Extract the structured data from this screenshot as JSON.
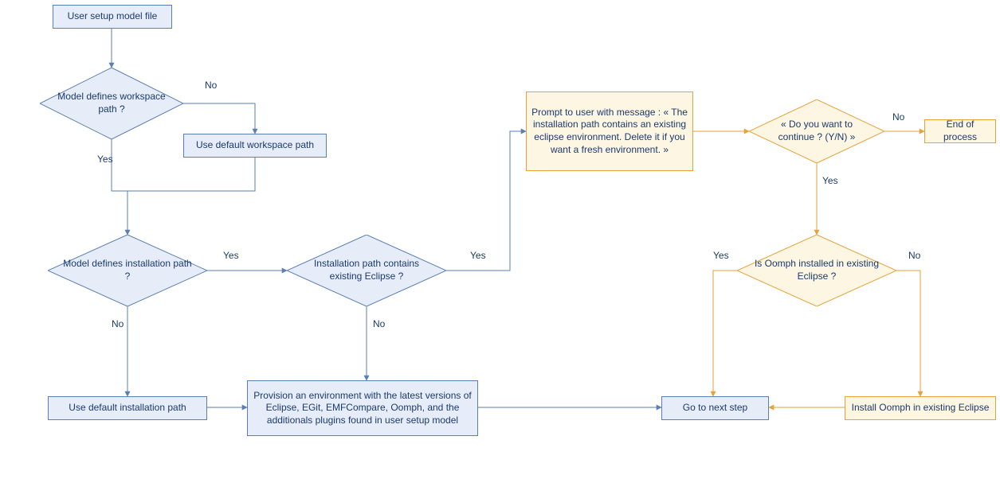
{
  "nodes": {
    "start": "User setup model file",
    "d_workspace": "Model defines workspace path ?",
    "use_default_ws": "Use default workspace path",
    "d_install": "Model defines installation path ?",
    "d_existing": "Installation path contains existing Eclipse ?",
    "use_default_install": "Use default installation path",
    "provision": "Provision an environment with the latest versions of Eclipse, EGit, EMFCompare, Oomph, and the additionals plugins found in user setup model",
    "prompt": "Prompt to user with message : « The installation path contains an existing eclipse environment. Delete it if you want a fresh environment. »",
    "d_continue": "« Do you want to continue ? (Y/N) »",
    "end": "End of process",
    "d_oomph": "Is Oomph installed in existing Eclipse ?",
    "install_oomph": "Install Oomph in existing Eclipse",
    "goto_next": "Go to next step"
  },
  "labels": {
    "yes": "Yes",
    "no": "No"
  },
  "colors": {
    "blue_stroke": "#5a7fb5",
    "blue_fill": "#e6ecf8",
    "orange_stroke": "#e6a23c",
    "orange_fill": "#fdf6e3"
  },
  "chart_data": {
    "type": "flowchart",
    "nodes": [
      {
        "id": "start",
        "type": "process",
        "text": "User setup model file",
        "style": "blue"
      },
      {
        "id": "d_workspace",
        "type": "decision",
        "text": "Model defines workspace path ?",
        "style": "blue"
      },
      {
        "id": "use_default_ws",
        "type": "process",
        "text": "Use default workspace path",
        "style": "blue"
      },
      {
        "id": "d_install",
        "type": "decision",
        "text": "Model defines installation path ?",
        "style": "blue"
      },
      {
        "id": "d_existing",
        "type": "decision",
        "text": "Installation path contains existing Eclipse ?",
        "style": "blue"
      },
      {
        "id": "use_default_install",
        "type": "process",
        "text": "Use default installation path",
        "style": "blue"
      },
      {
        "id": "provision",
        "type": "process",
        "text": "Provision an environment with the latest versions of Eclipse, EGit, EMFCompare, Oomph, and the additionals plugins found in user setup model",
        "style": "blue"
      },
      {
        "id": "prompt",
        "type": "process",
        "text": "Prompt to user with message : « The installation path contains an existing eclipse environment. Delete it if you want a fresh environment. »",
        "style": "orange"
      },
      {
        "id": "d_continue",
        "type": "decision",
        "text": "« Do you want to continue ? (Y/N) »",
        "style": "orange"
      },
      {
        "id": "end",
        "type": "process",
        "text": "End of process",
        "style": "orange"
      },
      {
        "id": "d_oomph",
        "type": "decision",
        "text": "Is Oomph installed in existing Eclipse ?",
        "style": "orange"
      },
      {
        "id": "install_oomph",
        "type": "process",
        "text": "Install Oomph in existing Eclipse",
        "style": "orange"
      },
      {
        "id": "goto_next",
        "type": "process",
        "text": "Go to next step",
        "style": "blue"
      }
    ],
    "edges": [
      {
        "from": "start",
        "to": "d_workspace"
      },
      {
        "from": "d_workspace",
        "to": "use_default_ws",
        "label": "No"
      },
      {
        "from": "d_workspace",
        "to": "d_install",
        "label": "Yes"
      },
      {
        "from": "use_default_ws",
        "to": "d_install"
      },
      {
        "from": "d_install",
        "to": "d_existing",
        "label": "Yes"
      },
      {
        "from": "d_install",
        "to": "use_default_install",
        "label": "No"
      },
      {
        "from": "use_default_install",
        "to": "provision"
      },
      {
        "from": "d_existing",
        "to": "provision",
        "label": "No"
      },
      {
        "from": "d_existing",
        "to": "prompt",
        "label": "Yes"
      },
      {
        "from": "provision",
        "to": "goto_next"
      },
      {
        "from": "prompt",
        "to": "d_continue"
      },
      {
        "from": "d_continue",
        "to": "end",
        "label": "No"
      },
      {
        "from": "d_continue",
        "to": "d_oomph",
        "label": "Yes"
      },
      {
        "from": "d_oomph",
        "to": "goto_next",
        "label": "Yes"
      },
      {
        "from": "d_oomph",
        "to": "install_oomph",
        "label": "No"
      },
      {
        "from": "install_oomph",
        "to": "goto_next"
      }
    ]
  }
}
